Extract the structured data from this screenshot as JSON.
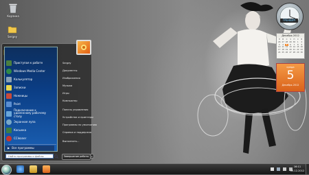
{
  "desktop": {
    "icons": [
      {
        "name": "recycle-bin",
        "label": "Корзина"
      },
      {
        "name": "folder",
        "label": "Sergey"
      }
    ]
  },
  "gadgets": {
    "clock_label": "ГРЕНВИЧ",
    "calendar_header": "Декабрь 2012",
    "calendar_weekdays": [
      "П",
      "В",
      "С",
      "Ч",
      "П",
      "С",
      "В"
    ],
    "calendar_days": [
      "26",
      "27",
      "28",
      "29",
      "30",
      "1",
      "2",
      "3",
      "4",
      "5",
      "6",
      "7",
      "8",
      "9",
      "10",
      "11",
      "12",
      "13",
      "14",
      "15",
      "16",
      "17",
      "18",
      "19",
      "20",
      "21",
      "22",
      "23",
      "24",
      "25",
      "26",
      "27",
      "28",
      "29",
      "30"
    ],
    "date_dow": "среда",
    "date_day": "5",
    "date_month_year": "Декабрь 2012"
  },
  "start_menu": {
    "programs": [
      {
        "label": "Приступая к работе",
        "color": "#4a7f3f"
      },
      {
        "label": "Windows Media Center",
        "color": "#2f8a45"
      },
      {
        "label": "Калькулятор",
        "color": "#8aa0b3"
      },
      {
        "label": "Записки",
        "color": "#e8d64f"
      },
      {
        "label": "Ножницы",
        "color": "#c94a3a"
      },
      {
        "label": "Paint",
        "color": "#5b8ed1"
      },
      {
        "label": "Подключение к удаленному рабочему столу",
        "color": "#6aa7d9"
      },
      {
        "label": "Экранная лупа",
        "color": "#79a8c8"
      },
      {
        "label": "Косынка",
        "color": "#3b7c45"
      },
      {
        "label": "CCleaner",
        "color": "#c9342b"
      }
    ],
    "all_programs": "Все программы",
    "search_placeholder": "Найти программы и файлы",
    "right_items": [
      "Sergey",
      "Документы",
      "Изображения",
      "Музыка",
      "Игры",
      "Компьютер",
      "Панель управления",
      "Устройства и принтеры",
      "Программы по умолчанию",
      "Справка и поддержка",
      "Выполнить..."
    ],
    "shutdown_label": "Завершение работы",
    "shutdown_arrow": "▸"
  },
  "taskbar": {
    "time": "16:11",
    "date": "05.12.2012",
    "tray_icons": [
      "flag-icon",
      "network-icon",
      "volume-icon",
      "language-icon"
    ],
    "pinned": [
      {
        "name": "ie-icon",
        "color": "#3a7fd4"
      },
      {
        "name": "explorer-icon",
        "color": "#e0b23a"
      },
      {
        "name": "media-player-icon",
        "color": "#e07a2a"
      }
    ]
  }
}
